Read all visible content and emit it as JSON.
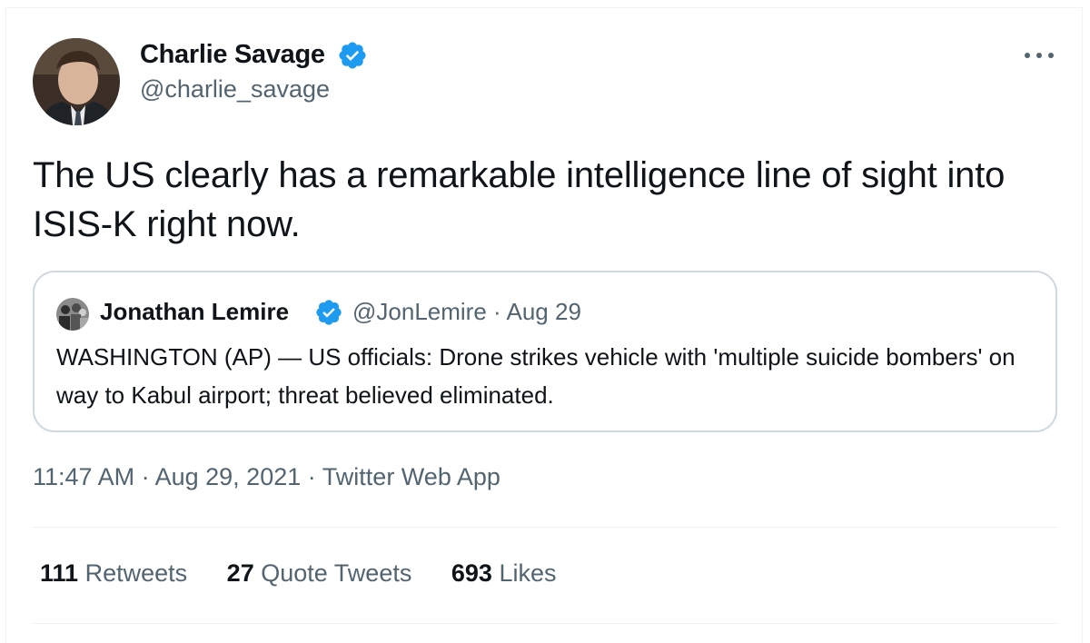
{
  "tweet": {
    "author_name": "Charlie Savage",
    "author_handle": "@charlie_savage",
    "text": "The US clearly has a remarkable intelligence line of sight into ISIS-K right now.",
    "timestamp": "11:47 AM",
    "date": "Aug 29, 2021",
    "source": "Twitter Web App",
    "separator": "·"
  },
  "quoted": {
    "author_name": "Jonathan Lemire",
    "author_handle": "@JonLemire",
    "separator": "·",
    "date": "Aug 29",
    "text": "WASHINGTON (AP) — US officials: Drone strikes vehicle with 'multiple suicide bombers' on way to Kabul airport; threat believed eliminated."
  },
  "stats": {
    "retweets_count": "111",
    "retweets_label": "Retweets",
    "quotes_count": "27",
    "quotes_label": "Quote Tweets",
    "likes_count": "693",
    "likes_label": "Likes"
  },
  "icons": {
    "verified": "verified-badge-icon",
    "more": "more-horizontal-icon"
  },
  "colors": {
    "verified_blue": "#1d9bf0",
    "text_primary": "#0f1419",
    "text_secondary": "#536471",
    "border": "#cfd9de",
    "divider": "#eff3f4"
  }
}
